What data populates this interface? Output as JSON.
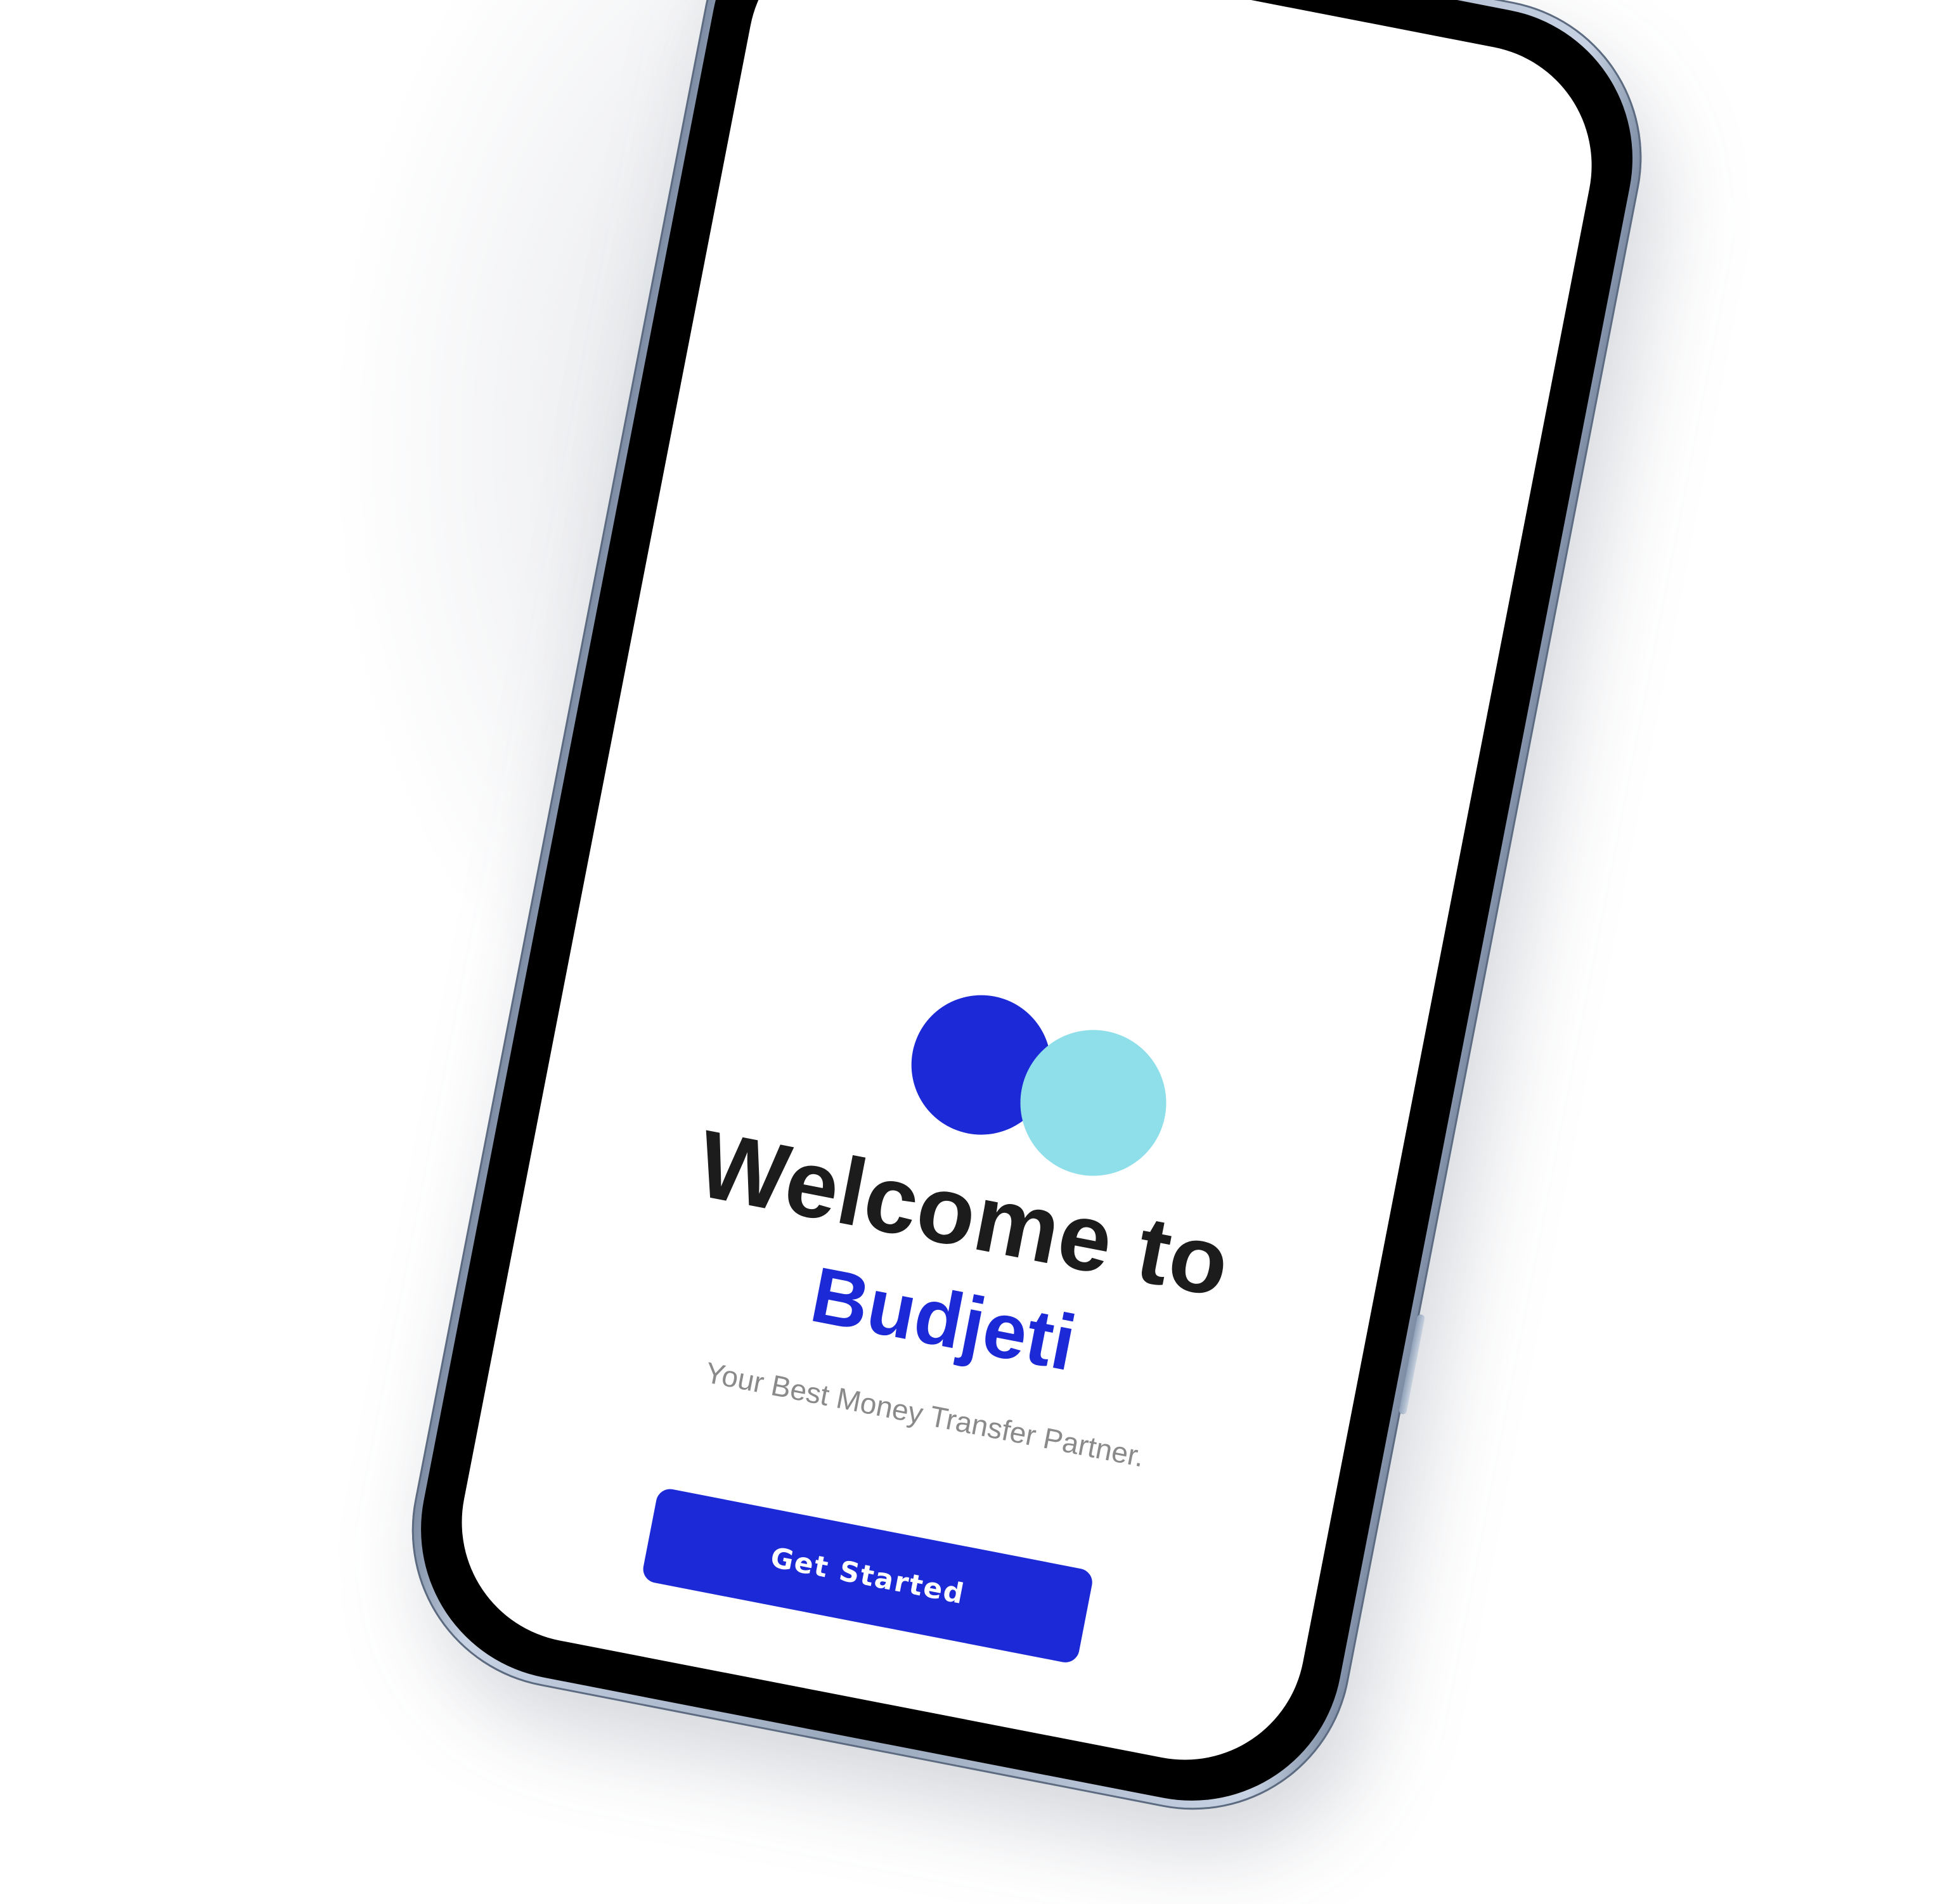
{
  "app": {
    "welcome_line": "Welcome to",
    "brand_name": "Budjeti",
    "tagline": "Your Best Money Transfer Partner.",
    "primary_action_label": "Get Started"
  },
  "colors": {
    "brand_blue": "#1b29d6",
    "accent_cyan": "#8fdfea",
    "title_text": "#1c1c1c",
    "tagline_text": "#8a8a8a",
    "phone_frame": "#9aa8bd"
  },
  "icons": {
    "logo": "two-overlapping-circles-logo-icon"
  }
}
